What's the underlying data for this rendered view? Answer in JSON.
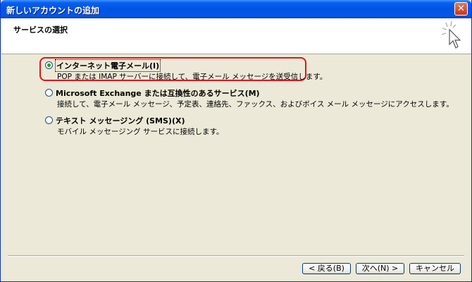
{
  "window": {
    "title": "新しいアカウントの追加",
    "close_symbol": "✕"
  },
  "header": {
    "title": "サービスの選択",
    "icon": "wizard-sparkle-cursor-icon"
  },
  "options": [
    {
      "label": "インターネット電子メール(I)",
      "description": "POP または IMAP サーバーに接続して、電子メール メッセージを送受信します。",
      "selected": true
    },
    {
      "label": "Microsoft Exchange または互換性のあるサービス(M)",
      "description": "接続して、電子メール メッセージ、予定表、連絡先、ファックス、およびボイス メール メッセージにアクセスします。",
      "selected": false
    },
    {
      "label": "テキスト メッセージング (SMS)(X)",
      "description": "モバイル メッセージング サービスに接続します。",
      "selected": false
    }
  ],
  "buttons": {
    "back": "< 戻る(B)",
    "next": "次へ(N) >",
    "cancel": "キャンセル"
  },
  "colors": {
    "title_bar": "#0054e3",
    "highlight_border": "#e0141e",
    "radio_dot": "#21a121"
  }
}
